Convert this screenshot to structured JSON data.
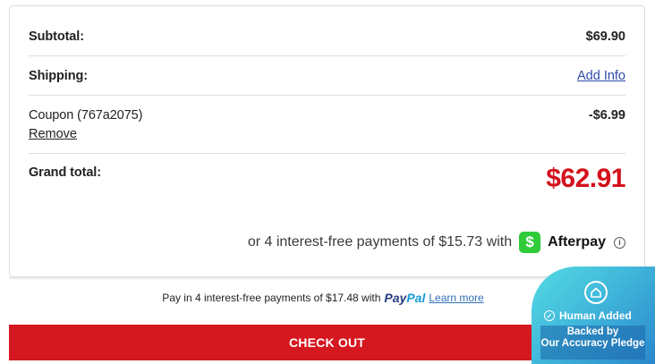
{
  "summary": {
    "subtotal_label": "Subtotal:",
    "subtotal_value": "$69.90",
    "shipping_label": "Shipping:",
    "shipping_action": "Add Info",
    "coupon_label": "Coupon (767a2075)",
    "coupon_value": "-$6.99",
    "coupon_remove": "Remove",
    "grand_total_label": "Grand total:",
    "grand_total_value": "$62.91"
  },
  "afterpay": {
    "text": "or 4 interest-free payments of $15.73 with",
    "cashapp_glyph": "$",
    "brand": "Afterpay",
    "info_glyph": "i"
  },
  "paypal": {
    "text": "Pay in 4 interest-free payments of $17.48 with",
    "logo_pay": "Pay",
    "logo_pal": "Pal",
    "learn_more": "Learn more"
  },
  "checkout": {
    "label": "CHECK OUT"
  },
  "pledge": {
    "title": "Human Added",
    "line1": "Backed by",
    "line2": "Our Accuracy Pledge"
  },
  "colors": {
    "accent_red": "#d5171f",
    "grand_total_red": "#d4111c",
    "link_blue": "#2f49a8",
    "cashapp_green": "#2fcb3a",
    "pledge_teal": "#41b8db"
  },
  "icons": {
    "cashapp": "cashapp-icon",
    "info": "info-icon",
    "pledge": "home-shield-icon",
    "check": "check-circle-icon"
  }
}
